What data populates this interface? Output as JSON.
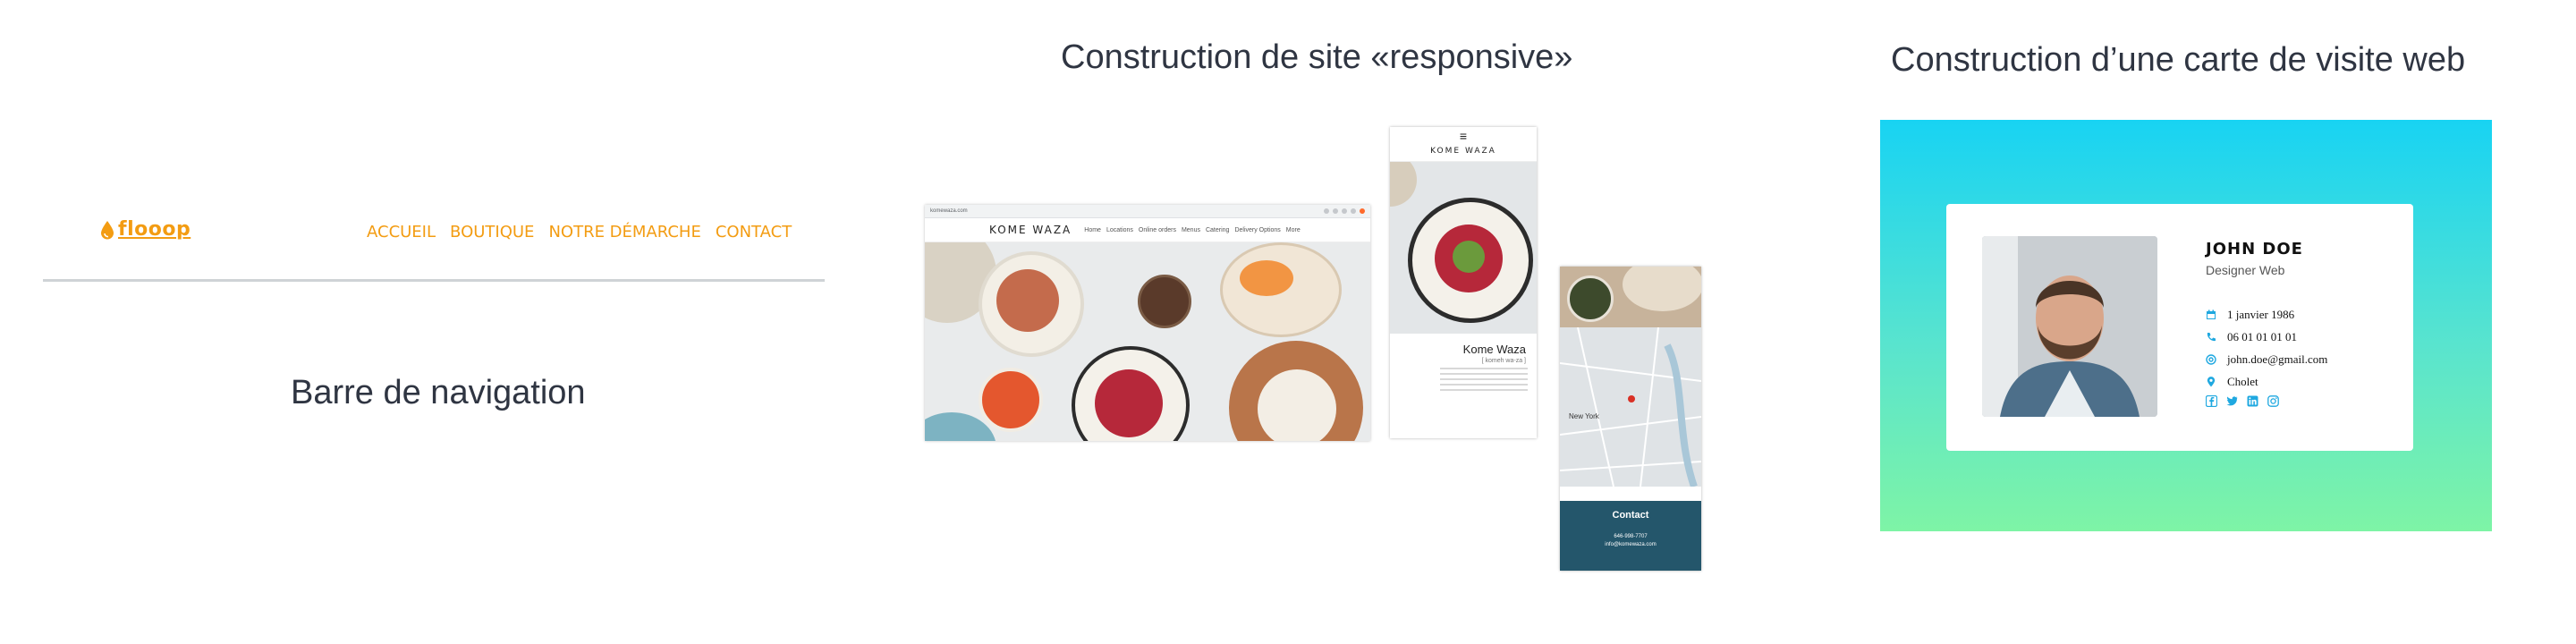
{
  "navbar_demo": {
    "logo_icon": "drop-icon",
    "logo_text": "flooop",
    "accent_color": "#f39c12",
    "menu": [
      "ACCUEIL",
      "BOUTIQUE",
      "NOTRE DÉMARCHE",
      "CONTACT"
    ],
    "caption": "Barre de navigation"
  },
  "responsive_demo": {
    "caption": "Construction de site «responsive»",
    "desktop": {
      "url": "komewaza.com",
      "brand": "KOME WAZA",
      "links": [
        "Home",
        "Locations",
        "Online orders",
        "Menus",
        "Catering",
        "Delivery Options",
        "More"
      ]
    },
    "tablet": {
      "menu_icon": "hamburger-icon",
      "brand": "KOME WAZA",
      "title": "Kome Waza",
      "subtitle": "[ komeh wa-za ]"
    },
    "phone": {
      "map_label": "New York",
      "contact_title": "Contact",
      "contact_lines": [
        "646-998-7707",
        "info@komewaza.com"
      ]
    }
  },
  "card_demo": {
    "caption": "Construction d’une carte de visite web",
    "gradient": [
      "#18d3f3",
      "#7ef4a6"
    ],
    "accent_color": "#1fa8e0",
    "name": "JOHN DOE",
    "role": "Designer Web",
    "info": [
      {
        "icon": "calendar-icon",
        "text": "1 janvier 1986"
      },
      {
        "icon": "phone-icon",
        "text": "06 01 01 01 01"
      },
      {
        "icon": "at-icon",
        "text": "john.doe@gmail.com"
      },
      {
        "icon": "location-pin-icon",
        "text": "Cholet"
      }
    ],
    "social_icons": [
      "facebook-icon",
      "twitter-icon",
      "linkedin-icon",
      "instagram-icon"
    ]
  }
}
